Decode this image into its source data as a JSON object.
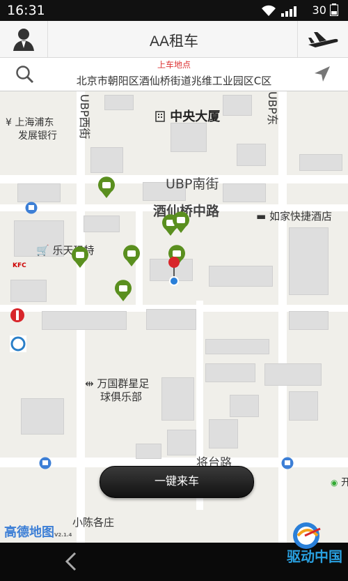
{
  "status_bar": {
    "time": "16:31",
    "battery": "30"
  },
  "header": {
    "title": "AA租车"
  },
  "pickup": {
    "label": "上车地点",
    "address": "北京市朝阳区酒仙桥街道兆维工业园区C区"
  },
  "map": {
    "labels": {
      "zhongyang": "中央大厦",
      "ubp_south": "UBP南街",
      "jiuxianqiao": "酒仙桥中路",
      "rujia": "如家快捷酒店",
      "shanghai_bank_1": "上海浦东",
      "shanghai_bank_2": "发展银行",
      "lotte": "乐天玛特",
      "wanguo_1": "万国群星足",
      "wanguo_2": "球俱乐部",
      "xiaochen": "小陈各庄",
      "ubp_west": "UBP西街",
      "ubp_east": "UBP东",
      "jiang_road": "将台路",
      "kai": "开",
      "kfc": "KFC"
    },
    "attribution": "高德地图",
    "attribution_ver": "V2.1.4"
  },
  "call_button": {
    "label": "一键来车"
  },
  "watermark": {
    "text": "驱动中国"
  },
  "colors": {
    "car_marker": "#5a8f1f",
    "pin": "#d8262b",
    "accent_red": "#d33"
  }
}
